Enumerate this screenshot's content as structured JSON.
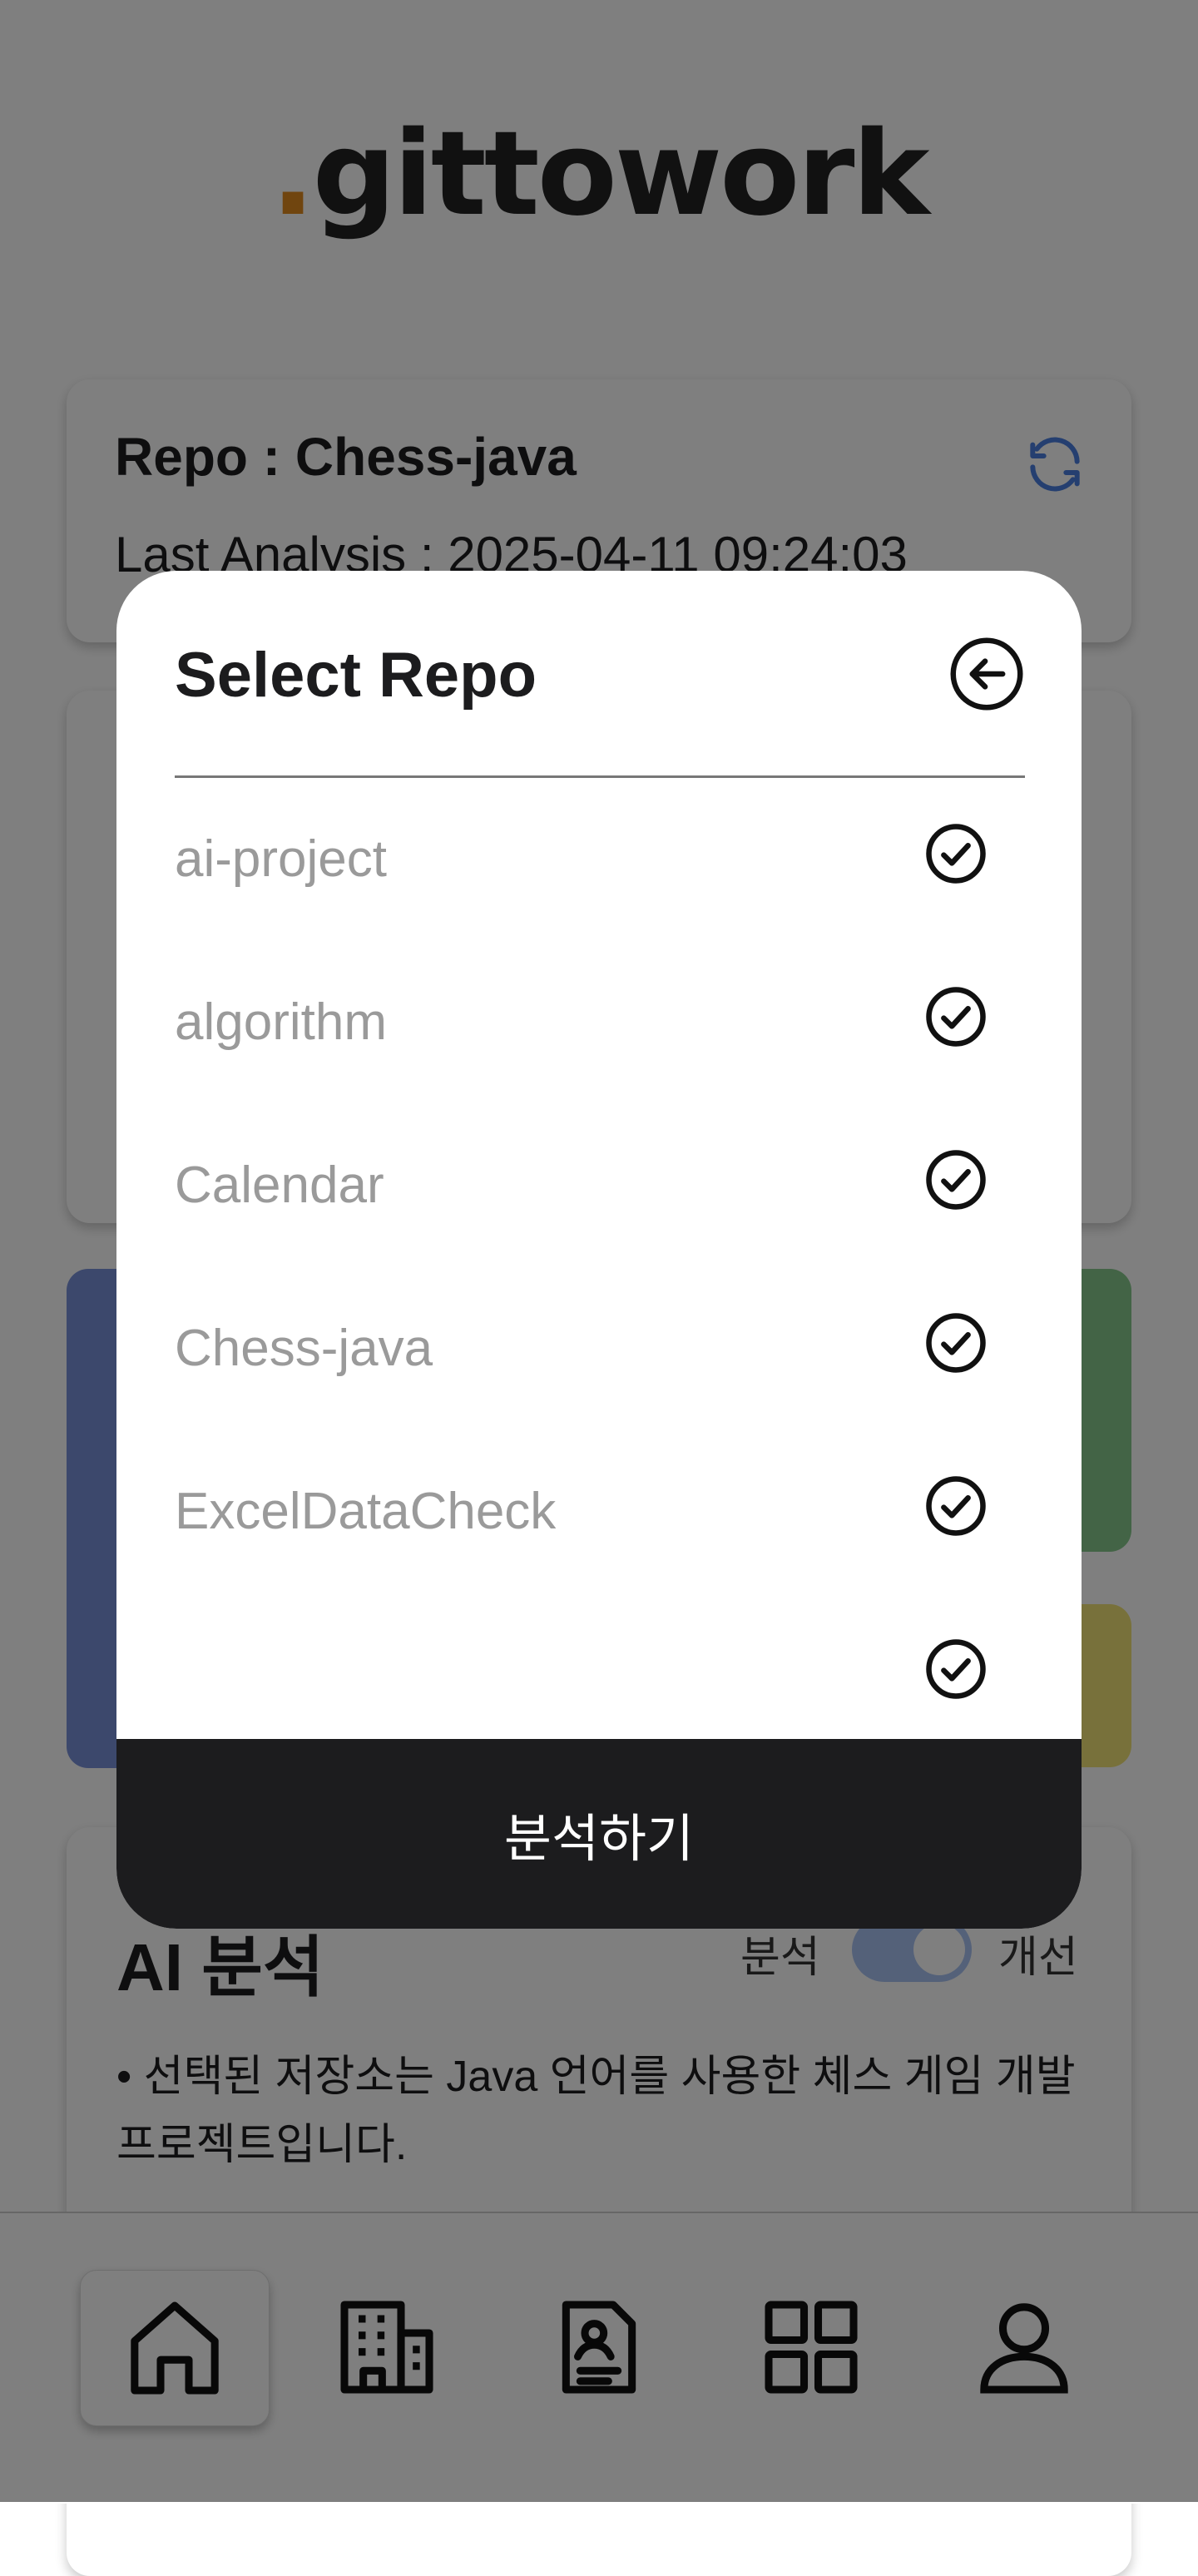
{
  "app": {
    "logo_dot": ".",
    "logo_text": "gittowork"
  },
  "repo_card": {
    "repo_label": "Repo : Chess-java",
    "last_analysis": "Last Analysis : 2025-04-11 09:24:03"
  },
  "ai_section": {
    "title": "AI 분석",
    "toggle_left": "분석",
    "toggle_right": "개선",
    "toggle_on": true,
    "text": "• 선택된 저장소는 Java 언어를 사용한 체스 게임 개발 프로젝트입니다."
  },
  "modal": {
    "title": "Select Repo",
    "repos": [
      {
        "name": "ai-project",
        "checked": true
      },
      {
        "name": "algorithm",
        "checked": true
      },
      {
        "name": "Calendar",
        "checked": true
      },
      {
        "name": "Chess-java",
        "checked": true
      },
      {
        "name": "ExcelDataCheck",
        "checked": true
      }
    ],
    "submit_label": "분석하기"
  },
  "nav": {
    "items": [
      {
        "icon": "home-icon",
        "active": true
      },
      {
        "icon": "building-icon",
        "active": false
      },
      {
        "icon": "resume-icon",
        "active": false
      },
      {
        "icon": "grid-icon",
        "active": false
      },
      {
        "icon": "user-icon",
        "active": false
      }
    ]
  },
  "colors": {
    "accent_dot": "#e08a1e",
    "card_blue": "#7890d8",
    "card_green": "#86c98c",
    "card_yellow": "#f1e277",
    "button_dark": "#1c1c1e"
  }
}
